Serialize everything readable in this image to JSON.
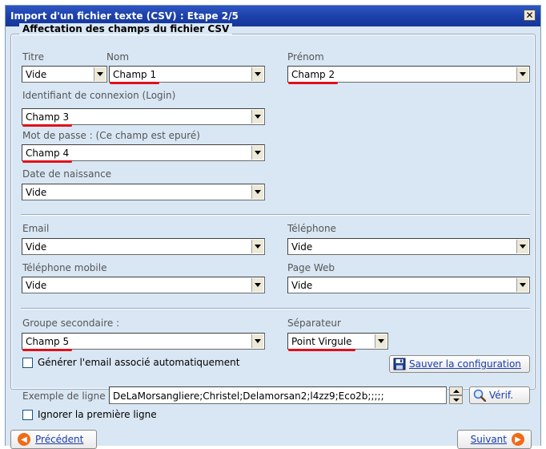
{
  "window": {
    "title": "Import d'un fichier texte (CSV) : Etape 2/5",
    "close_symbol": "✕"
  },
  "group": {
    "legend": "Affectation des champs du fichier CSV"
  },
  "fields": {
    "titre": {
      "label": "Titre",
      "value": "Vide"
    },
    "nom": {
      "label": "Nom",
      "value": "Champ 1"
    },
    "prenom": {
      "label": "Prénom",
      "value": "Champ 2"
    },
    "login": {
      "label": "Identifiant de connexion (Login)",
      "value": "Champ 3"
    },
    "password": {
      "label": "Mot de passe : (Ce champ est epuré)",
      "value": "Champ 4"
    },
    "birthdate": {
      "label": "Date de naissance",
      "value": "Vide"
    },
    "email": {
      "label": "Email",
      "value": "Vide"
    },
    "telephone": {
      "label": "Téléphone",
      "value": "Vide"
    },
    "mobile": {
      "label": "Téléphone mobile",
      "value": "Vide"
    },
    "pageweb": {
      "label": "Page Web",
      "value": "Vide"
    },
    "groupe": {
      "label": "Groupe secondaire :",
      "value": "Champ 5"
    },
    "separateur": {
      "label": "Séparateur",
      "value": "Point Virgule"
    }
  },
  "options": {
    "generate_email": "Générer l'email associé automatiquement",
    "ignore_first_line": "Ignorer la première ligne"
  },
  "buttons": {
    "save_config": "Sauver la configuration",
    "verify": "Vérif.",
    "previous": "Précédent",
    "next": "Suivant"
  },
  "example": {
    "label": "Exemple de ligne :",
    "value": "DeLaMorsangliere;Christel;Delamorsan2;l4zz9;Eco2b;;;;;"
  }
}
